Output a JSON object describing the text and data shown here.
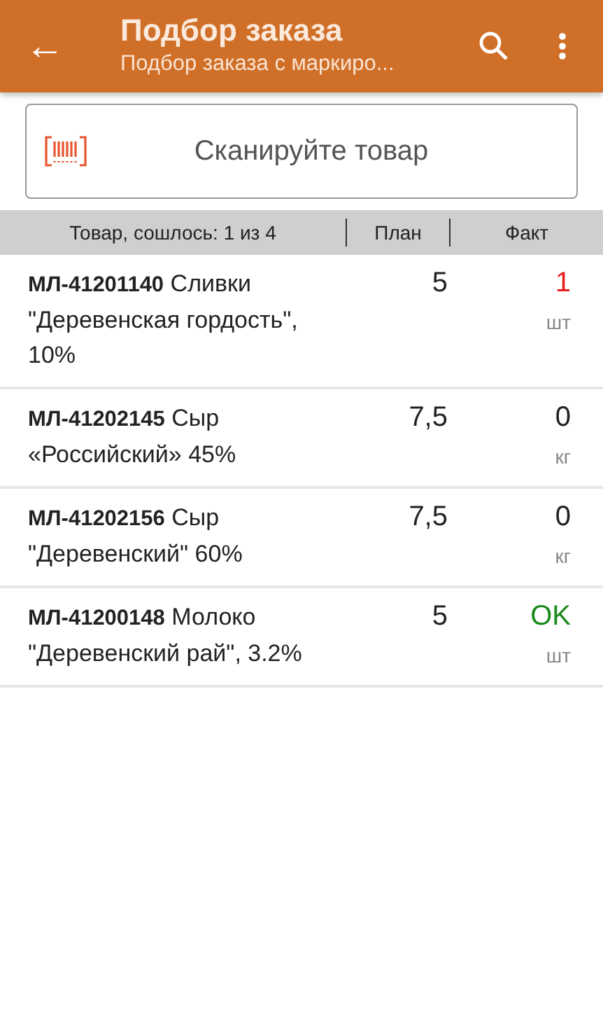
{
  "app_bar": {
    "back": "←",
    "title": "Подбор заказа",
    "subtitle": "Подбор заказа с маркиро..."
  },
  "scan_field": {
    "placeholder": "Сканируйте товар"
  },
  "table": {
    "columns": [
      "Товар, сошлось: 1 из 4",
      "План",
      "Факт"
    ],
    "rows": [
      {
        "name": "**МЛ-41201140** Сливки \"Деревенская гордость\", 10%",
        "plan": "5",
        "fact": "1",
        "unit": "шт",
        "color": "#e81a1a"
      },
      {
        "name": "**МЛ-41202145** Сыр «Российский» 45%",
        "plan": "7,5",
        "fact": "0",
        "unit": "кг",
        "color": "#222222"
      },
      {
        "name": "**МЛ-41202156** Сыр \"Деревенский\" 60%",
        "plan": "7,5",
        "fact": "0",
        "unit": "кг",
        "color": "#222222"
      },
      {
        "name": "**МЛ-41200148** Молоко \"Деревенский рай\", 3.2%",
        "plan": "5",
        "fact": "OK",
        "unit": "шт",
        "color": "#1a8a1a"
      }
    ]
  }
}
